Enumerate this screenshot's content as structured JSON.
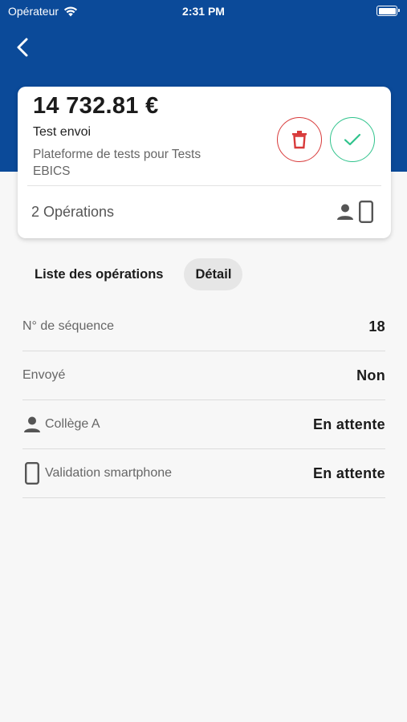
{
  "status_bar": {
    "carrier": "Opérateur",
    "time": "2:31 PM"
  },
  "card": {
    "amount": "14 732.81 €",
    "name": "Test envoi",
    "description": "Plateforme de tests pour Tests EBICS",
    "operations_count": "2 Opérations",
    "icons": [
      "person-icon",
      "smartphone-icon"
    ]
  },
  "tabs": [
    {
      "label": "Liste des opérations",
      "active": false
    },
    {
      "label": "Détail",
      "active": true
    }
  ],
  "details": [
    {
      "label": "N° de séquence",
      "value": "18",
      "icon": null
    },
    {
      "label": "Envoyé",
      "value": "Non",
      "icon": null
    },
    {
      "label": "Collège A",
      "value": "En attente",
      "icon": "person-icon"
    },
    {
      "label": "Validation smartphone",
      "value": "En attente",
      "icon": "smartphone-icon"
    }
  ],
  "colors": {
    "header": "#0b4a99",
    "delete": "#d83a3a",
    "validate": "#2fc38c"
  }
}
